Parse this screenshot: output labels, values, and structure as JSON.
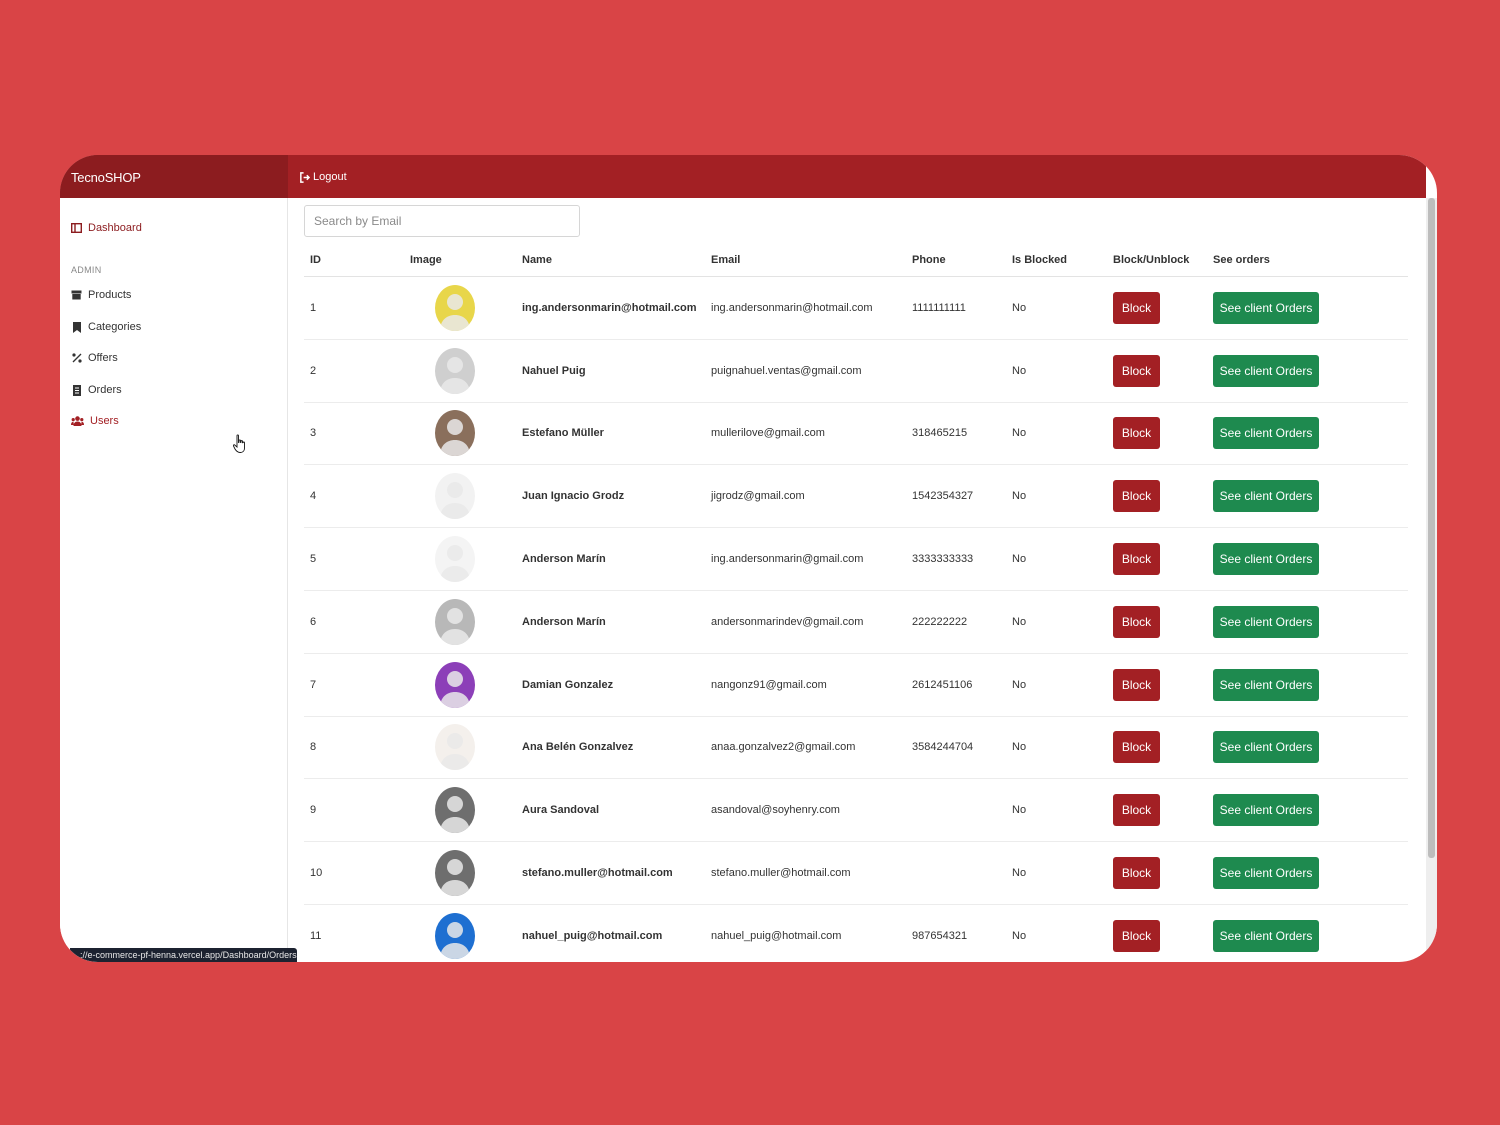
{
  "brand": "TecnoSHOP",
  "header": {
    "logout_label": "Logout"
  },
  "sidebar": {
    "dashboard": "Dashboard",
    "admin_heading": "ADMIN",
    "items": [
      {
        "label": "Products",
        "icon": "box-icon"
      },
      {
        "label": "Categories",
        "icon": "bookmark-icon"
      },
      {
        "label": "Offers",
        "icon": "percent-icon"
      },
      {
        "label": "Orders",
        "icon": "receipt-icon"
      },
      {
        "label": "Users",
        "icon": "users-icon"
      }
    ]
  },
  "search": {
    "placeholder": "Search by Email",
    "value": ""
  },
  "table": {
    "columns": [
      "ID",
      "Image",
      "Name",
      "Email",
      "Phone",
      "Is Blocked",
      "Block/Unblock",
      "See orders"
    ],
    "block_label": "Block",
    "orders_label": "See client Orders",
    "rows": [
      {
        "id": "1",
        "name": "ing.andersonmarin@hotmail.com",
        "email": "ing.andersonmarin@hotmail.com",
        "phone": "1111111111",
        "blocked": "No",
        "avatar_bg": "#e8d64a"
      },
      {
        "id": "2",
        "name": "Nahuel Puig",
        "email": "puignahuel.ventas@gmail.com",
        "phone": "",
        "blocked": "No",
        "avatar_bg": "#cfcfcf"
      },
      {
        "id": "3",
        "name": "Estefano Müller",
        "email": "mullerilove@gmail.com",
        "phone": "318465215",
        "blocked": "No",
        "avatar_bg": "#8a6f5c"
      },
      {
        "id": "4",
        "name": "Juan Ignacio Grodz",
        "email": "jigrodz@gmail.com",
        "phone": "1542354327",
        "blocked": "No",
        "avatar_bg": "#f2f2f2"
      },
      {
        "id": "5",
        "name": "Anderson Marín",
        "email": "ing.andersonmarin@gmail.com",
        "phone": "3333333333",
        "blocked": "No",
        "avatar_bg": "#f4f4f4"
      },
      {
        "id": "6",
        "name": "Anderson Marín",
        "email": "andersonmarindev@gmail.com",
        "phone": "222222222",
        "blocked": "No",
        "avatar_bg": "#b8b8b8"
      },
      {
        "id": "7",
        "name": "Damian Gonzalez",
        "email": "nangonz91@gmail.com",
        "phone": "2612451106",
        "blocked": "No",
        "avatar_bg": "#8c3fb8"
      },
      {
        "id": "8",
        "name": "Ana Belén Gonzalvez",
        "email": "anaa.gonzalvez2@gmail.com",
        "phone": "3584244704",
        "blocked": "No",
        "avatar_bg": "#f4f0ec"
      },
      {
        "id": "9",
        "name": "Aura Sandoval",
        "email": "asandoval@soyhenry.com",
        "phone": "",
        "blocked": "No",
        "avatar_bg": "#6e6e6e"
      },
      {
        "id": "10",
        "name": "stefano.muller@hotmail.com",
        "email": "stefano.muller@hotmail.com",
        "phone": "",
        "blocked": "No",
        "avatar_bg": "#6e6e6e"
      },
      {
        "id": "11",
        "name": "nahuel_puig@hotmail.com",
        "email": "nahuel_puig@hotmail.com",
        "phone": "987654321",
        "blocked": "No",
        "avatar_bg": "#1e6fd1"
      }
    ]
  },
  "status_bar_url": "://e-commerce-pf-henna.vercel.app/Dashboard/Orders",
  "colors": {
    "page_bg": "#d94446",
    "header": "#a32024",
    "brand_bg": "#8c1c1f",
    "block_button": "#a32024",
    "orders_button": "#1e8a4f"
  }
}
